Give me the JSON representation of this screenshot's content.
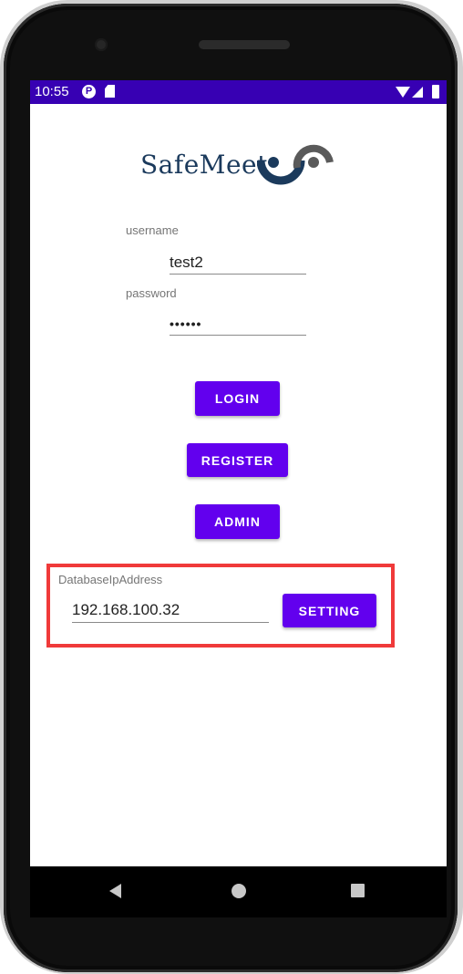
{
  "status_bar": {
    "time": "10:55",
    "icons": [
      "p-notification-icon",
      "sd-card-icon",
      "wifi-icon",
      "signal-icon",
      "battery-icon"
    ]
  },
  "logo": {
    "text": "SafeMeet",
    "colors": {
      "text": "#1b3a5c",
      "mark_dark": "#1b3a5c",
      "mark_light": "#5a5a5a"
    }
  },
  "login_form": {
    "username_label": "username",
    "username_value": "test2",
    "password_label": "password",
    "password_value": "••••••"
  },
  "buttons": {
    "login": "LOGIN",
    "register": "REGISTER",
    "admin": "ADMIN"
  },
  "database": {
    "label": "DatabaseIpAddress",
    "ip_value": "192.168.100.32",
    "setting_button": "SETTING"
  },
  "theme": {
    "primary": "#6200ee",
    "status_bar": "#3700b3",
    "highlight": "#f03a3a"
  },
  "nav_bar": {
    "items": [
      "back-icon",
      "home-icon",
      "recents-icon"
    ]
  }
}
